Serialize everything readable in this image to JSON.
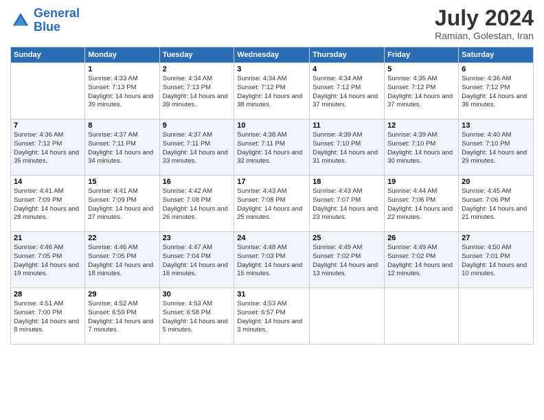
{
  "header": {
    "logo_line1": "General",
    "logo_line2": "Blue",
    "month": "July 2024",
    "location": "Ramian, Golestan, Iran"
  },
  "weekdays": [
    "Sunday",
    "Monday",
    "Tuesday",
    "Wednesday",
    "Thursday",
    "Friday",
    "Saturday"
  ],
  "weeks": [
    [
      {
        "day": "",
        "sunrise": "",
        "sunset": "",
        "daylight": ""
      },
      {
        "day": "1",
        "sunrise": "Sunrise: 4:33 AM",
        "sunset": "Sunset: 7:13 PM",
        "daylight": "Daylight: 14 hours and 39 minutes."
      },
      {
        "day": "2",
        "sunrise": "Sunrise: 4:34 AM",
        "sunset": "Sunset: 7:13 PM",
        "daylight": "Daylight: 14 hours and 39 minutes."
      },
      {
        "day": "3",
        "sunrise": "Sunrise: 4:34 AM",
        "sunset": "Sunset: 7:12 PM",
        "daylight": "Daylight: 14 hours and 38 minutes."
      },
      {
        "day": "4",
        "sunrise": "Sunrise: 4:34 AM",
        "sunset": "Sunset: 7:12 PM",
        "daylight": "Daylight: 14 hours and 37 minutes."
      },
      {
        "day": "5",
        "sunrise": "Sunrise: 4:35 AM",
        "sunset": "Sunset: 7:12 PM",
        "daylight": "Daylight: 14 hours and 37 minutes."
      },
      {
        "day": "6",
        "sunrise": "Sunrise: 4:36 AM",
        "sunset": "Sunset: 7:12 PM",
        "daylight": "Daylight: 14 hours and 36 minutes."
      }
    ],
    [
      {
        "day": "7",
        "sunrise": "Sunrise: 4:36 AM",
        "sunset": "Sunset: 7:12 PM",
        "daylight": "Daylight: 14 hours and 35 minutes."
      },
      {
        "day": "8",
        "sunrise": "Sunrise: 4:37 AM",
        "sunset": "Sunset: 7:11 PM",
        "daylight": "Daylight: 14 hours and 34 minutes."
      },
      {
        "day": "9",
        "sunrise": "Sunrise: 4:37 AM",
        "sunset": "Sunset: 7:11 PM",
        "daylight": "Daylight: 14 hours and 33 minutes."
      },
      {
        "day": "10",
        "sunrise": "Sunrise: 4:38 AM",
        "sunset": "Sunset: 7:11 PM",
        "daylight": "Daylight: 14 hours and 32 minutes."
      },
      {
        "day": "11",
        "sunrise": "Sunrise: 4:39 AM",
        "sunset": "Sunset: 7:10 PM",
        "daylight": "Daylight: 14 hours and 31 minutes."
      },
      {
        "day": "12",
        "sunrise": "Sunrise: 4:39 AM",
        "sunset": "Sunset: 7:10 PM",
        "daylight": "Daylight: 14 hours and 30 minutes."
      },
      {
        "day": "13",
        "sunrise": "Sunrise: 4:40 AM",
        "sunset": "Sunset: 7:10 PM",
        "daylight": "Daylight: 14 hours and 29 minutes."
      }
    ],
    [
      {
        "day": "14",
        "sunrise": "Sunrise: 4:41 AM",
        "sunset": "Sunset: 7:09 PM",
        "daylight": "Daylight: 14 hours and 28 minutes."
      },
      {
        "day": "15",
        "sunrise": "Sunrise: 4:41 AM",
        "sunset": "Sunset: 7:09 PM",
        "daylight": "Daylight: 14 hours and 27 minutes."
      },
      {
        "day": "16",
        "sunrise": "Sunrise: 4:42 AM",
        "sunset": "Sunset: 7:08 PM",
        "daylight": "Daylight: 14 hours and 26 minutes."
      },
      {
        "day": "17",
        "sunrise": "Sunrise: 4:43 AM",
        "sunset": "Sunset: 7:08 PM",
        "daylight": "Daylight: 14 hours and 25 minutes."
      },
      {
        "day": "18",
        "sunrise": "Sunrise: 4:43 AM",
        "sunset": "Sunset: 7:07 PM",
        "daylight": "Daylight: 14 hours and 23 minutes."
      },
      {
        "day": "19",
        "sunrise": "Sunrise: 4:44 AM",
        "sunset": "Sunset: 7:06 PM",
        "daylight": "Daylight: 14 hours and 22 minutes."
      },
      {
        "day": "20",
        "sunrise": "Sunrise: 4:45 AM",
        "sunset": "Sunset: 7:06 PM",
        "daylight": "Daylight: 14 hours and 21 minutes."
      }
    ],
    [
      {
        "day": "21",
        "sunrise": "Sunrise: 4:46 AM",
        "sunset": "Sunset: 7:05 PM",
        "daylight": "Daylight: 14 hours and 19 minutes."
      },
      {
        "day": "22",
        "sunrise": "Sunrise: 4:46 AM",
        "sunset": "Sunset: 7:05 PM",
        "daylight": "Daylight: 14 hours and 18 minutes."
      },
      {
        "day": "23",
        "sunrise": "Sunrise: 4:47 AM",
        "sunset": "Sunset: 7:04 PM",
        "daylight": "Daylight: 14 hours and 16 minutes."
      },
      {
        "day": "24",
        "sunrise": "Sunrise: 4:48 AM",
        "sunset": "Sunset: 7:03 PM",
        "daylight": "Daylight: 14 hours and 15 minutes."
      },
      {
        "day": "25",
        "sunrise": "Sunrise: 4:49 AM",
        "sunset": "Sunset: 7:02 PM",
        "daylight": "Daylight: 14 hours and 13 minutes."
      },
      {
        "day": "26",
        "sunrise": "Sunrise: 4:49 AM",
        "sunset": "Sunset: 7:02 PM",
        "daylight": "Daylight: 14 hours and 12 minutes."
      },
      {
        "day": "27",
        "sunrise": "Sunrise: 4:50 AM",
        "sunset": "Sunset: 7:01 PM",
        "daylight": "Daylight: 14 hours and 10 minutes."
      }
    ],
    [
      {
        "day": "28",
        "sunrise": "Sunrise: 4:51 AM",
        "sunset": "Sunset: 7:00 PM",
        "daylight": "Daylight: 14 hours and 8 minutes."
      },
      {
        "day": "29",
        "sunrise": "Sunrise: 4:52 AM",
        "sunset": "Sunset: 6:59 PM",
        "daylight": "Daylight: 14 hours and 7 minutes."
      },
      {
        "day": "30",
        "sunrise": "Sunrise: 4:53 AM",
        "sunset": "Sunset: 6:58 PM",
        "daylight": "Daylight: 14 hours and 5 minutes."
      },
      {
        "day": "31",
        "sunrise": "Sunrise: 4:53 AM",
        "sunset": "Sunset: 6:57 PM",
        "daylight": "Daylight: 14 hours and 3 minutes."
      },
      {
        "day": "",
        "sunrise": "",
        "sunset": "",
        "daylight": ""
      },
      {
        "day": "",
        "sunrise": "",
        "sunset": "",
        "daylight": ""
      },
      {
        "day": "",
        "sunrise": "",
        "sunset": "",
        "daylight": ""
      }
    ]
  ]
}
